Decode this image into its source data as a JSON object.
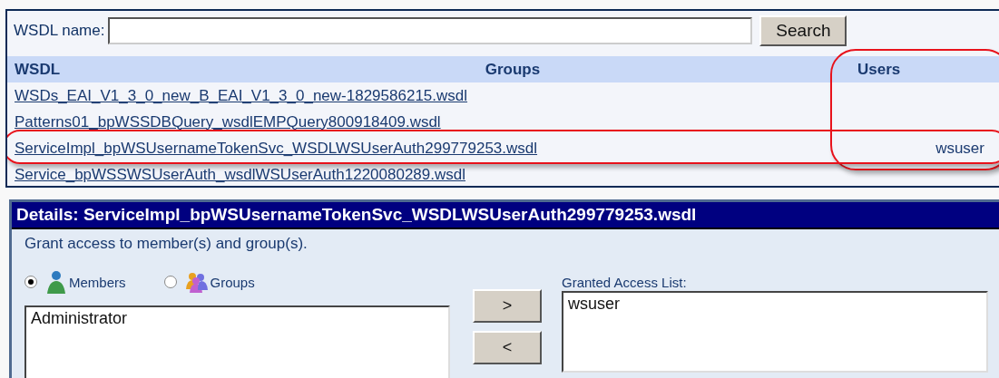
{
  "search": {
    "label": "WSDL name:",
    "button": "Search"
  },
  "table": {
    "columns": [
      {
        "label": "WSDL",
        "circled": false
      },
      {
        "label": "Groups",
        "circled": false
      },
      {
        "label": "Users",
        "circled": true
      }
    ],
    "rows": [
      {
        "wsdl": "WSDs_EAI_V1_3_0_new_B_EAI_V1_3_0_new-1829586215.wsdl",
        "circled": false
      },
      {
        "wsdl": "Patterns01_bpWSSDBQuery_wsdlEMPQuery800918409.wsdl",
        "circled": false
      },
      {
        "wsdl": "ServiceImpl_bpWSUsernameTokenSvc_WSDLWSUserAuth299779253.wsdl",
        "users": "wsuser",
        "circled": true
      },
      {
        "wsdl": "Service_bpWSSWSUserAuth_wsdlWSUserAuth1220080289.wsdl",
        "circled": false
      }
    ]
  },
  "details": {
    "title": "Details: ServiceImpl_bpWSUsernameTokenSvc_WSDLWSUserAuth299779253.wsdl",
    "instruction": "Grant access to member(s) and group(s).",
    "options": [
      {
        "label": "Members",
        "kind": "member",
        "selected": true
      },
      {
        "label": "Groups",
        "kind": "group",
        "selected": false
      }
    ],
    "available": [
      "Administrator"
    ],
    "add_button": ">",
    "remove_button": "<",
    "granted_label": "Granted Access List:",
    "granted": [
      "wsuser"
    ]
  }
}
